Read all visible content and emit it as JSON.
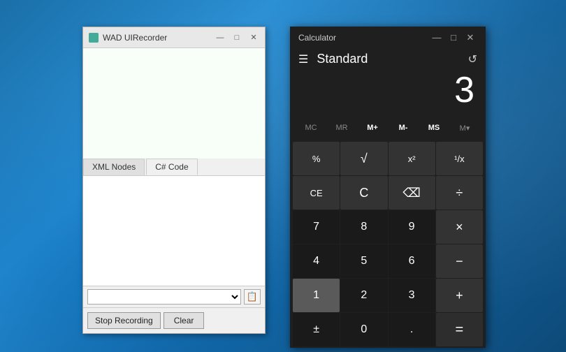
{
  "desktop": {
    "background": "Windows 10 teal desktop"
  },
  "wad_window": {
    "title": "WAD UIRecorder",
    "minimize": "—",
    "maximize": "□",
    "close": "✕",
    "tabs": [
      {
        "label": "XML Nodes",
        "active": false
      },
      {
        "label": "C# Code",
        "active": true
      }
    ],
    "dropdown_value": "",
    "stop_recording_label": "Stop Recording",
    "clear_label": "Clear",
    "copy_icon": "📋"
  },
  "calculator": {
    "title": "Calculator",
    "minimize": "—",
    "maximize": "□",
    "close": "✕",
    "header_title": "Standard",
    "display_value": "3",
    "memory_buttons": [
      {
        "label": "MC",
        "active": false
      },
      {
        "label": "MR",
        "active": false
      },
      {
        "label": "M+",
        "active": true
      },
      {
        "label": "M-",
        "active": true
      },
      {
        "label": "MS",
        "active": true
      },
      {
        "label": "M▾",
        "active": false
      }
    ],
    "buttons": [
      {
        "label": "%",
        "type": "op"
      },
      {
        "label": "√",
        "type": "op"
      },
      {
        "label": "x²",
        "type": "op"
      },
      {
        "label": "¹/x",
        "type": "op"
      },
      {
        "label": "CE",
        "type": "op"
      },
      {
        "label": "C",
        "type": "op"
      },
      {
        "label": "⌫",
        "type": "op"
      },
      {
        "label": "÷",
        "type": "op"
      },
      {
        "label": "7",
        "type": "num"
      },
      {
        "label": "8",
        "type": "num"
      },
      {
        "label": "9",
        "type": "num"
      },
      {
        "label": "×",
        "type": "op"
      },
      {
        "label": "4",
        "type": "num"
      },
      {
        "label": "5",
        "type": "num"
      },
      {
        "label": "6",
        "type": "num"
      },
      {
        "label": "−",
        "type": "op"
      },
      {
        "label": "1",
        "type": "num-1"
      },
      {
        "label": "2",
        "type": "num"
      },
      {
        "label": "3",
        "type": "num"
      },
      {
        "label": "+",
        "type": "op"
      },
      {
        "label": "±",
        "type": "num"
      },
      {
        "label": "0",
        "type": "num"
      },
      {
        "label": ".",
        "type": "num"
      },
      {
        "label": "=",
        "type": "equals"
      }
    ]
  }
}
